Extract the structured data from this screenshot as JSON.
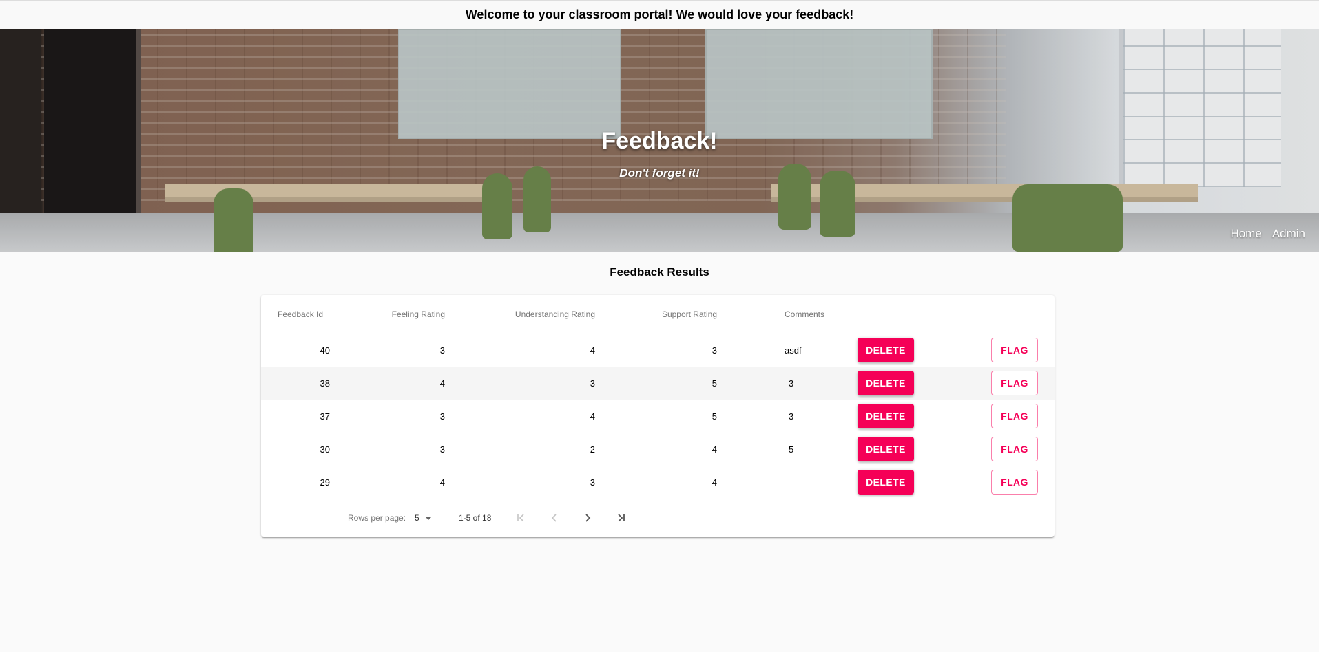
{
  "banner": {
    "text": "Welcome to your classroom portal! We would love your feedback!"
  },
  "hero": {
    "title": "Feedback!",
    "subtitle": "Don't forget it!"
  },
  "nav": {
    "home": "Home",
    "admin": "Admin"
  },
  "section": {
    "title": "Feedback Results"
  },
  "table": {
    "headers": {
      "id": "Feedback Id",
      "feeling": "Feeling Rating",
      "understanding": "Understanding Rating",
      "support": "Support Rating",
      "comments": "Comments"
    },
    "rows": [
      {
        "id": "40",
        "feeling": "3",
        "understanding": "4",
        "support": "3",
        "comments": "asdf",
        "delete": "DELETE",
        "flag": "FLAG"
      },
      {
        "id": "38",
        "feeling": "4",
        "understanding": "3",
        "support": "5",
        "comments": "3",
        "delete": "DELETE",
        "flag": "FLAG"
      },
      {
        "id": "37",
        "feeling": "3",
        "understanding": "4",
        "support": "5",
        "comments": "3",
        "delete": "DELETE",
        "flag": "FLAG"
      },
      {
        "id": "30",
        "feeling": "3",
        "understanding": "2",
        "support": "4",
        "comments": "5",
        "delete": "DELETE",
        "flag": "FLAG"
      },
      {
        "id": "29",
        "feeling": "4",
        "understanding": "3",
        "support": "4",
        "comments": "",
        "delete": "DELETE",
        "flag": "FLAG"
      }
    ]
  },
  "pagination": {
    "rows_per_page_label": "Rows per page:",
    "rows_per_page_value": "5",
    "range": "1-5 of 18",
    "icons": [
      "first-page-icon",
      "previous-page-icon",
      "next-page-icon",
      "last-page-icon"
    ]
  },
  "colors": {
    "accent": "#f50057",
    "background": "#fafafa"
  }
}
